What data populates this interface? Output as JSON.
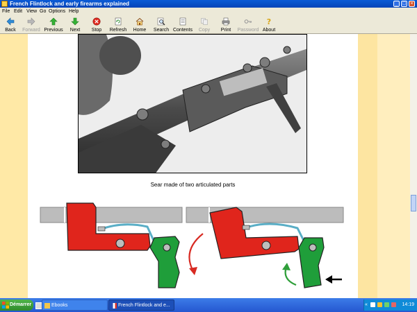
{
  "window": {
    "title": "French Flintlock and early firearms explained",
    "controls": [
      "_",
      "□",
      "×"
    ]
  },
  "menu": [
    "File",
    "Edit",
    "View",
    "Go",
    "Options",
    "Help"
  ],
  "toolbar": {
    "back": "Back",
    "forward": "Forward",
    "previous": "Previous",
    "next": "Next",
    "stop": "Stop",
    "refresh": "Refresh",
    "home": "Home",
    "search": "Search",
    "contents": "Contents",
    "copy": "Copy",
    "print": "Print",
    "password": "Password",
    "about": "About"
  },
  "page": {
    "caption": "Sear made of two articulated parts"
  },
  "taskbar": {
    "start": "Démarrer",
    "tasks": [
      "Ebooks",
      "French Flintlock and e..."
    ],
    "tray_chevron": "«",
    "clock": "14:19"
  },
  "colors": {
    "sear_red": "#e0251c",
    "trigger_green": "#1f9e3a",
    "spring_blue": "#5aaec6",
    "rail_gray": "#b9b9b9"
  }
}
